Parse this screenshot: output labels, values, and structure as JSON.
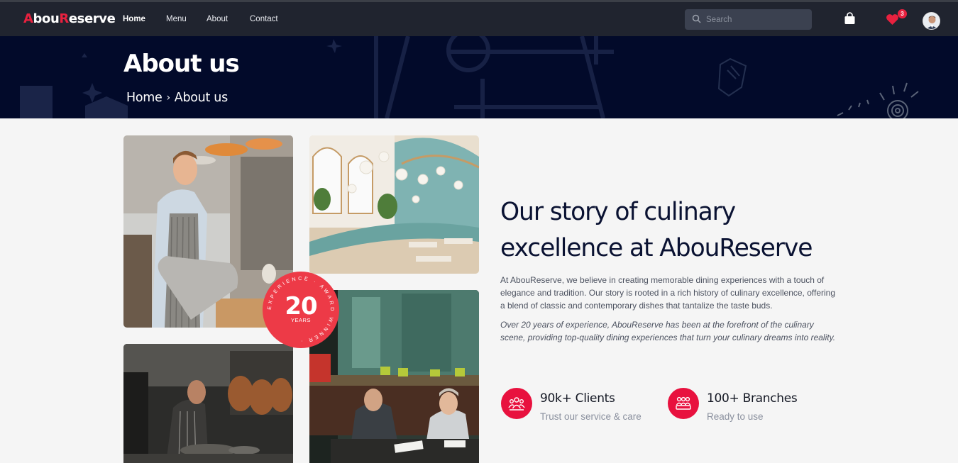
{
  "brand": {
    "part1": "A",
    "part2": "bou",
    "part3": "R",
    "part4": "eserve"
  },
  "nav": {
    "links": [
      {
        "label": "Home"
      },
      {
        "label": "Menu"
      },
      {
        "label": "About"
      },
      {
        "label": "Contact"
      }
    ],
    "search_placeholder": "Search",
    "favorites_count": "3",
    "icons": [
      "search-icon",
      "shopping-bag-icon",
      "heart-icon",
      "avatar"
    ]
  },
  "hero": {
    "title": "About us",
    "breadcrumb": {
      "home": "Home",
      "separator": "›",
      "current": "About us"
    }
  },
  "award": {
    "number": "20",
    "unit": "YEARS",
    "ring_text": "EXPERIENCE · AWARD WINNER ·"
  },
  "story": {
    "heading_line1": "Our story of culinary",
    "heading_line2": "excellence at AbouReserve",
    "paragraph1": "At AbouReserve, we believe in creating memorable dining experiences with a touch of elegance and tradition. Our story is rooted in a rich history of culinary excellence, offering a blend of classic and contemporary dishes that tantalize the taste buds.",
    "paragraph2": "Over 20 years of experience, AbouReserve has been at the forefront of the culinary scene, providing top-quality dining experiences that turn your culinary dreams into reality."
  },
  "stats": [
    {
      "title": "90k+ Clients",
      "subtitle": "Trust our service & care",
      "icon": "users-icon"
    },
    {
      "title": "100+ Branches",
      "subtitle": "Ready to use",
      "icon": "team-icon"
    }
  ],
  "colors": {
    "accent": "#e8213f",
    "navbar": "#20242f",
    "hero": "#020a2a",
    "heading": "#0a1232"
  }
}
